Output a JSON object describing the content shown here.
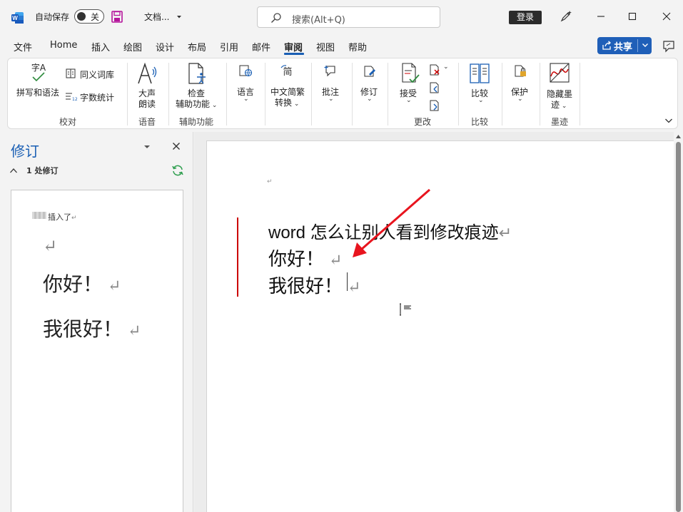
{
  "titlebar": {
    "autosave_label": "自动保存",
    "autosave_state": "关",
    "doc_name": "文档...",
    "search_placeholder": "搜索(Alt+Q)",
    "login_label": "登录"
  },
  "menu": {
    "tabs": [
      "文件",
      "Home",
      "插入",
      "绘图",
      "设计",
      "布局",
      "引用",
      "邮件",
      "审阅",
      "视图",
      "帮助"
    ],
    "active": "审阅",
    "share_label": "共享"
  },
  "ribbon": {
    "spelling": "拼写和语法",
    "thesaurus": "同义词库",
    "wordcount": "字数统计",
    "proofing_group": "校对",
    "read_aloud_1": "大声",
    "read_aloud_2": "朗读",
    "speech_group": "语音",
    "check_access_1": "检查",
    "check_access_2": "辅助功能",
    "accessibility_group": "辅助功能",
    "language": "语言",
    "chinese_convert_1": "中文简繁",
    "chinese_convert_2": "转换",
    "comment": "批注",
    "track": "修订",
    "accept": "接受",
    "changes_group": "更改",
    "compare": "比较",
    "compare_group": "比较",
    "protect": "保护",
    "hide_ink_1": "隐藏墨",
    "hide_ink_2": "迹",
    "ink_group": "墨迹",
    "zh_icon_char": "字A",
    "trad_icon_char": "简"
  },
  "panel": {
    "title": "修订",
    "count": "1 处修订",
    "action": "插入了",
    "lines": [
      "你好！",
      "我很好！"
    ]
  },
  "document": {
    "lines": [
      "word 怎么让别人看到修改痕迹",
      "你好！",
      "我很好！"
    ],
    "return_mark": "↵"
  },
  "colors": {
    "accent": "#1a5fb4",
    "change_bar": "#cc0000",
    "annotation_arrow": "#e8141e"
  }
}
